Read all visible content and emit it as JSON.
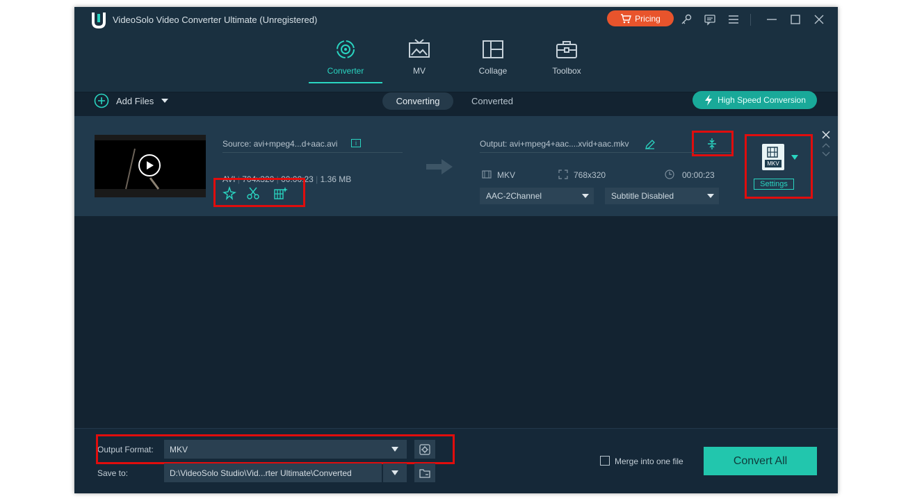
{
  "window": {
    "title": "VideoSolo Video Converter Ultimate (Unregistered)",
    "pricing_label": "Pricing"
  },
  "nav": {
    "tabs": [
      {
        "label": "Converter",
        "icon": "converter-icon"
      },
      {
        "label": "MV",
        "icon": "mv-icon"
      },
      {
        "label": "Collage",
        "icon": "collage-icon"
      },
      {
        "label": "Toolbox",
        "icon": "toolbox-icon"
      }
    ],
    "active": "Converter"
  },
  "toolbar": {
    "add_files_label": "Add Files",
    "converting_label": "Converting",
    "converted_label": "Converted",
    "high_speed_label": "High Speed Conversion"
  },
  "file": {
    "source_label": "Source: avi+mpeg4...d+aac.avi",
    "format": "AVI",
    "resolution": "704x320",
    "duration": "00:00:23",
    "size": "1.36 MB",
    "output_label": "Output: avi+mpeg4+aac....xvid+aac.mkv",
    "output_format": "MKV",
    "output_resolution": "768x320",
    "output_duration": "00:00:23",
    "audio_option": "AAC-2Channel",
    "subtitle_option": "Subtitle Disabled",
    "format_badge": "MKV",
    "settings_label": "Settings"
  },
  "bottom": {
    "output_format_label": "Output Format:",
    "output_format_value": "MKV",
    "save_to_label": "Save to:",
    "save_to_value": "D:\\VideoSolo Studio\\Vid...rter Ultimate\\Converted",
    "merge_label": "Merge into one file",
    "convert_all_label": "Convert All"
  },
  "colors": {
    "accent": "#2ad5c1",
    "background": "#132331",
    "pricing": "#e8542c",
    "highlight_box": "#e00d0d",
    "convert_button": "#22c6ad"
  }
}
